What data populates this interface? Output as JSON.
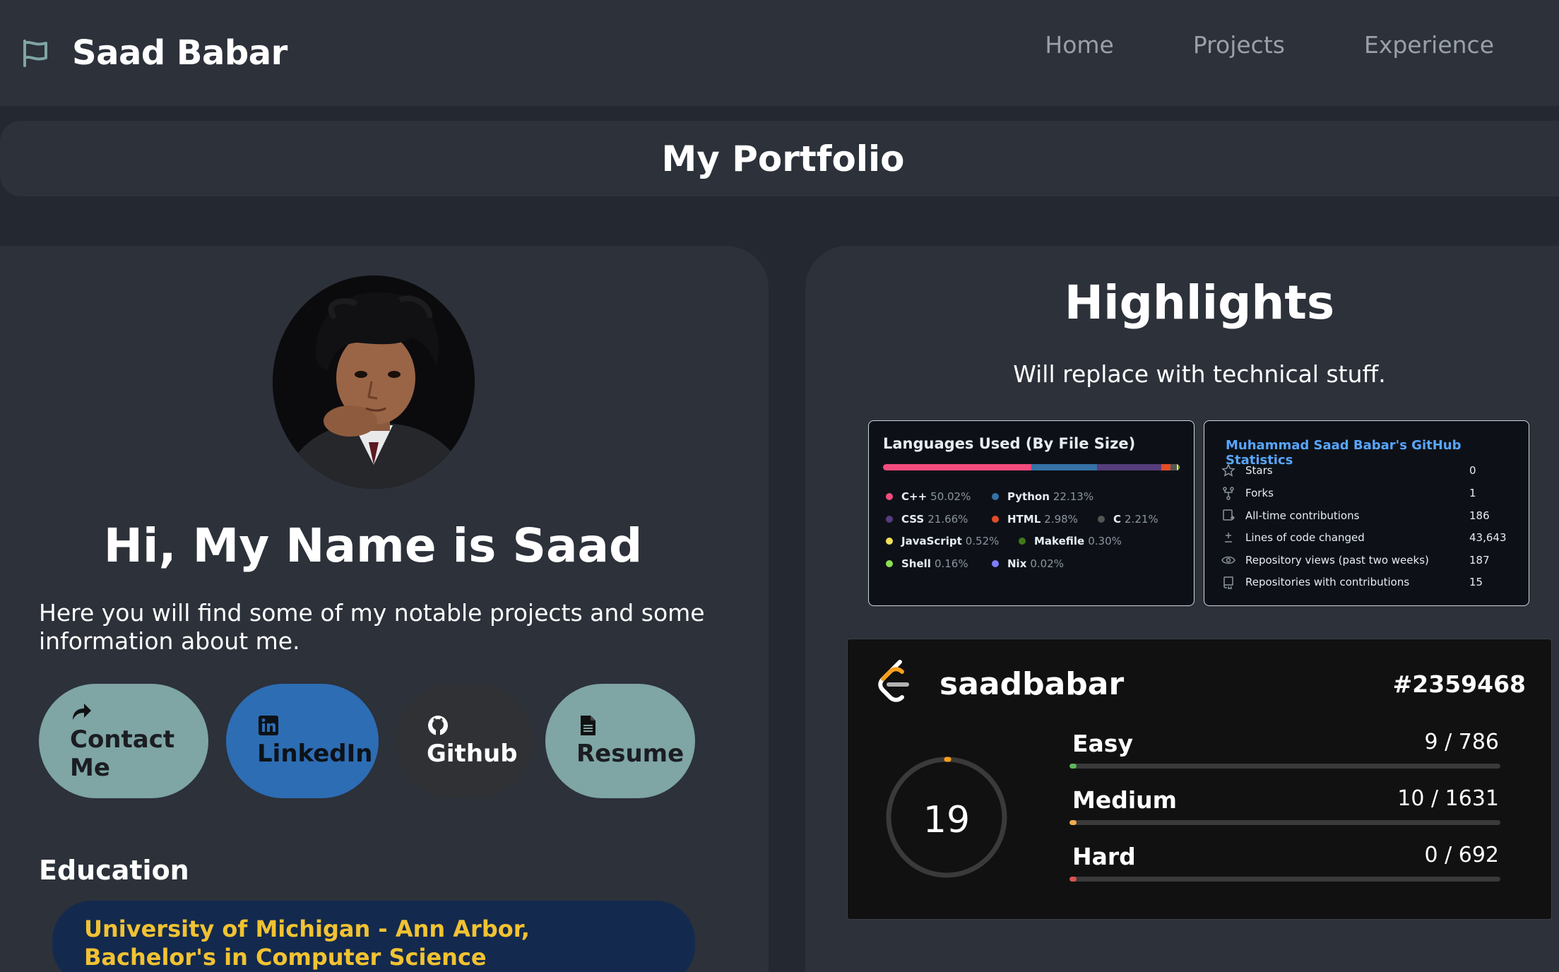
{
  "nav": {
    "brand": "Saad Babar",
    "links": [
      "Home",
      "Projects",
      "Experience"
    ]
  },
  "title_bar": {
    "title": "My Portfolio"
  },
  "profile": {
    "greeting": "Hi, My Name is Saad",
    "intro": "Here you will find some of my notable projects and some information about me.",
    "buttons": [
      {
        "label": "Contact Me",
        "icon": "share-arrow-icon"
      },
      {
        "label": "LinkedIn",
        "icon": "linkedin-icon"
      },
      {
        "label": "Github",
        "icon": "github-icon"
      },
      {
        "label": "Resume",
        "icon": "document-icon"
      }
    ],
    "education_heading": "Education",
    "education_items": [
      "University of Michigan - Ann Arbor, Bachelor's in Computer Science"
    ]
  },
  "highlights": {
    "title": "Highlights",
    "subtitle": "Will replace with technical stuff.",
    "languages": {
      "title": "Languages Used (By File Size)",
      "items": [
        {
          "name": "C++",
          "percent": "50.02%",
          "color": "#f34b7d"
        },
        {
          "name": "Python",
          "percent": "22.13%",
          "color": "#3572A5"
        },
        {
          "name": "CSS",
          "percent": "21.66%",
          "color": "#563d7c"
        },
        {
          "name": "HTML",
          "percent": "2.98%",
          "color": "#e34c26"
        },
        {
          "name": "C",
          "percent": "2.21%",
          "color": "#555555"
        },
        {
          "name": "JavaScript",
          "percent": "0.52%",
          "color": "#f1e05a"
        },
        {
          "name": "Makefile",
          "percent": "0.30%",
          "color": "#427819"
        },
        {
          "name": "Shell",
          "percent": "0.16%",
          "color": "#89e051"
        },
        {
          "name": "Nix",
          "percent": "0.02%",
          "color": "#7e7eff"
        }
      ]
    },
    "github_stats": {
      "title": "Muhammad Saad Babar's GitHub Statistics",
      "rows": [
        {
          "label": "Stars",
          "value": "0",
          "icon": "star-icon"
        },
        {
          "label": "Forks",
          "value": "1",
          "icon": "fork-icon"
        },
        {
          "label": "All-time contributions",
          "value": "186",
          "icon": "contributions-icon"
        },
        {
          "label": "Lines of code changed",
          "value": "43,643",
          "icon": "diff-icon"
        },
        {
          "label": "Repository views (past two weeks)",
          "value": "187",
          "icon": "eye-icon"
        },
        {
          "label": "Repositories with contributions",
          "value": "15",
          "icon": "repo-icon"
        }
      ]
    },
    "leetcode": {
      "username": "saadbabar",
      "rank": "#2359468",
      "total_solved": "19",
      "difficulties": [
        {
          "name": "Easy",
          "solved": 9,
          "total": 786,
          "text": "9 / 786",
          "color": "#5cb85c"
        },
        {
          "name": "Medium",
          "solved": 10,
          "total": 1631,
          "text": "10 / 1631",
          "color": "#f0ad4e"
        },
        {
          "name": "Hard",
          "solved": 0,
          "total": 692,
          "text": "0 / 692",
          "color": "#d9534f"
        }
      ]
    }
  }
}
